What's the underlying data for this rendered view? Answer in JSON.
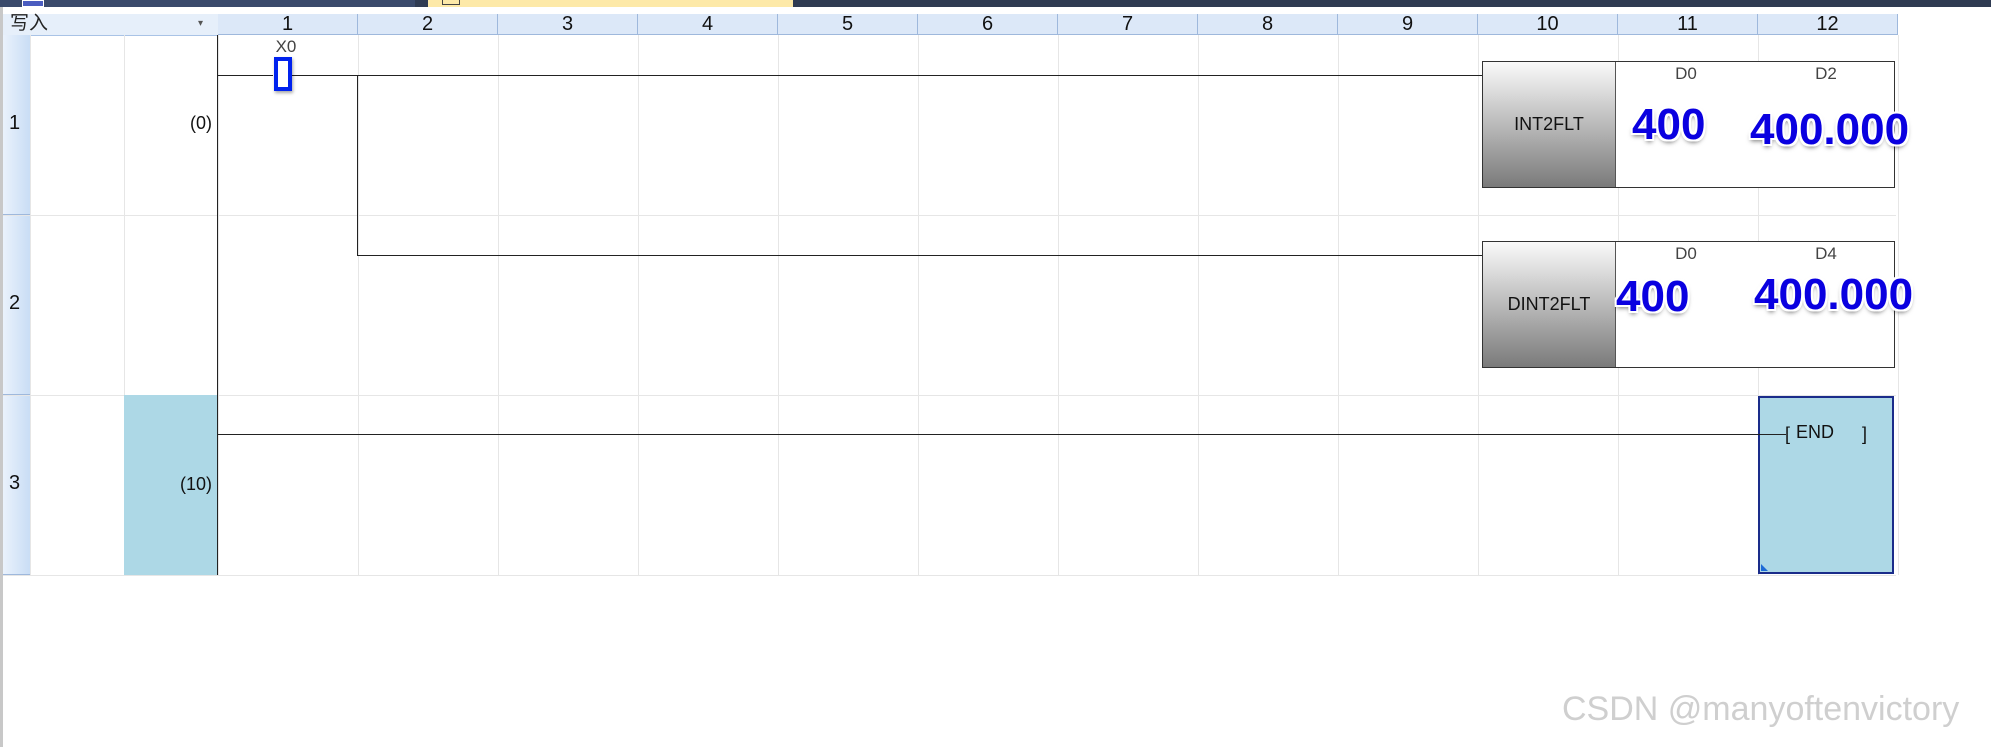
{
  "editor": {
    "mode_label": "写入",
    "mode_dropdown_icon": "chevron-down-icon"
  },
  "columns": [
    "1",
    "2",
    "3",
    "4",
    "5",
    "6",
    "7",
    "8",
    "9",
    "10",
    "11",
    "12"
  ],
  "rows": [
    {
      "num": "1",
      "step": "(0)"
    },
    {
      "num": "2",
      "step": ""
    },
    {
      "num": "3",
      "step": "(10)"
    }
  ],
  "rung1": {
    "contact": "X0",
    "instr1": {
      "name": "INT2FLT",
      "src": "D0",
      "dst": "D2",
      "src_value": "400",
      "dst_value": "400.000"
    },
    "instr2": {
      "name": "DINT2FLT",
      "src": "D0",
      "dst": "D4",
      "src_value": "400",
      "dst_value": "400.000"
    }
  },
  "end_instruction": {
    "label": "END",
    "open_bracket": "[",
    "close_bracket": "]"
  },
  "watermark": "CSDN @manyoftenvictory",
  "colors": {
    "header_bg": "#dce8f8",
    "selection_bg": "#add8e6",
    "value_text": "#0a00e0",
    "cursor": "#0022ee"
  }
}
